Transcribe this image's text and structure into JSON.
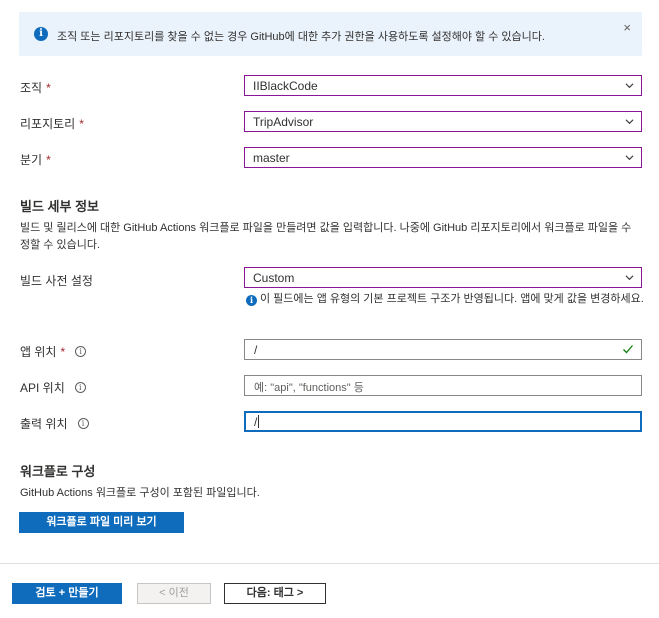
{
  "banner": {
    "message": "조직 또는 리포지토리를 찾을 수 없는 경우 GitHub에 대한 추가 권한을 사용하도록 설정해야 할 수 있습니다.",
    "close": "×"
  },
  "repo_fields": {
    "org_label": "조직",
    "org_value": "IIBlackCode",
    "repo_label": "리포지토리",
    "repo_value": "TripAdvisor",
    "branch_label": "분기",
    "branch_value": "master",
    "required_marker": "*"
  },
  "build_details": {
    "heading": "빌드 세부 정보",
    "description": "빌드 및 릴리스에 대한 GitHub Actions 워크플로 파일을 만들려면 값을 입력합니다. 나중에 GitHub 리포지토리에서 워크플로 파일을 수정할 수 있습니다.",
    "preset_label": "빌드 사전 설정",
    "preset_value": "Custom",
    "preset_hint": "이 필드에는 앱 유형의 기본 프로젝트 구조가 반영됩니다. 앱에 맞게 값을 변경하세요.",
    "app_location_label": "앱 위치",
    "app_location_value": "/",
    "api_location_label": "API 위치",
    "api_location_placeholder": "예: \"api\", \"functions\" 등",
    "output_location_label": "출력 위치",
    "output_location_value": "/"
  },
  "workflow": {
    "heading": "워크플로 구성",
    "description": "GitHub Actions 워크플로 구성이 포함된 파일입니다.",
    "preview_button": "워크플로 파일 미리 보기"
  },
  "footer": {
    "review_button": "검토 + 만들기",
    "prev_button": "< 이전",
    "next_button": "다음: 태그 >"
  },
  "colors": {
    "accent": "#0f6cbd",
    "dropdown_border": "#881798",
    "required": "#a4262c",
    "valid_check": "#107c10",
    "banner_bg": "#eaf3fb"
  },
  "icons": {
    "banner": "info-icon",
    "dropdown": "chevron-down-icon",
    "valid": "checkmark-icon",
    "tooltip": "info-outline-icon"
  }
}
